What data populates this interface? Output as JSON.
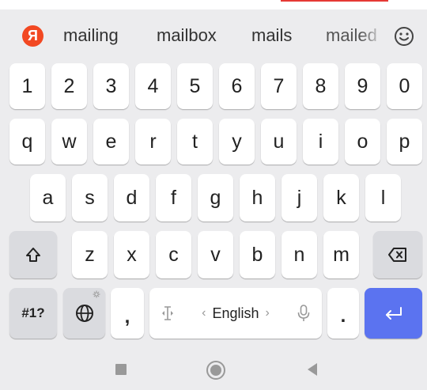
{
  "suggestions": {
    "logo_letter": "Я",
    "words": [
      "mailing",
      "mailbox",
      "mails",
      "mailed"
    ],
    "emoji_icon": "smiley-icon"
  },
  "keyboard": {
    "row_numbers": [
      "1",
      "2",
      "3",
      "4",
      "5",
      "6",
      "7",
      "8",
      "9",
      "0"
    ],
    "row_top": [
      "q",
      "w",
      "e",
      "r",
      "t",
      "y",
      "u",
      "i",
      "o",
      "p"
    ],
    "row_middle": [
      "a",
      "s",
      "d",
      "f",
      "g",
      "h",
      "j",
      "k",
      "l"
    ],
    "row_bottom": [
      "z",
      "x",
      "c",
      "v",
      "b",
      "n",
      "m"
    ],
    "shift_icon": "shift-icon",
    "backspace_icon": "backspace-icon",
    "symbols_label": "#1?",
    "globe_icon": "globe-icon",
    "comma_label": ",",
    "cursor_icon": "cursor-move-icon",
    "language": "English",
    "mic_icon": "microphone-icon",
    "period_label": ".",
    "enter_icon": "enter-icon",
    "enter_color": "#5b73f0"
  },
  "navigation": {
    "recent_icon": "square-icon",
    "home_icon": "home-circle-icon",
    "back_icon": "back-triangle-icon"
  }
}
